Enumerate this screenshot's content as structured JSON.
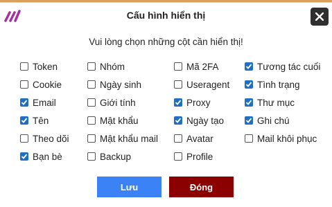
{
  "dialog": {
    "title": "Cấu hình hiển thị",
    "subtitle": "Vui lòng chọn những cột cần hiển thị!"
  },
  "columns": [
    {
      "label": "Token",
      "checked": false
    },
    {
      "label": "Cookie",
      "checked": false
    },
    {
      "label": "Email",
      "checked": true
    },
    {
      "label": "Tên",
      "checked": true
    },
    {
      "label": "Theo dõi",
      "checked": false
    },
    {
      "label": "Bạn bè",
      "checked": true
    },
    {
      "label": "Nhóm",
      "checked": false
    },
    {
      "label": "Ngày sinh",
      "checked": false
    },
    {
      "label": "Giới tính",
      "checked": false
    },
    {
      "label": "Mật khẩu",
      "checked": false
    },
    {
      "label": "Mật khẩu mail",
      "checked": false
    },
    {
      "label": "Backup",
      "checked": false
    },
    {
      "label": "Mã 2FA",
      "checked": false
    },
    {
      "label": "Useragent",
      "checked": false
    },
    {
      "label": "Proxy",
      "checked": true
    },
    {
      "label": "Ngày tạo",
      "checked": true
    },
    {
      "label": "Avatar",
      "checked": false
    },
    {
      "label": "Profile",
      "checked": false
    },
    {
      "label": "Tương tác cuối",
      "checked": true
    },
    {
      "label": "Tình trạng",
      "checked": true
    },
    {
      "label": "Thư mục",
      "checked": true
    },
    {
      "label": "Ghi chú",
      "checked": true
    },
    {
      "label": "Mail khôi phục",
      "checked": false
    }
  ],
  "buttons": {
    "save_label": "Lưu",
    "close_label": "Đóng"
  },
  "colors": {
    "checkbox_checked": "#1f6fc5",
    "save_button": "#3b82f6",
    "close_button": "#8b0000",
    "close_icon_bg": "#2f2f2f"
  },
  "icons": {
    "logo": "app-logo-icon",
    "close": "close-icon",
    "check": "checkmark-icon"
  }
}
